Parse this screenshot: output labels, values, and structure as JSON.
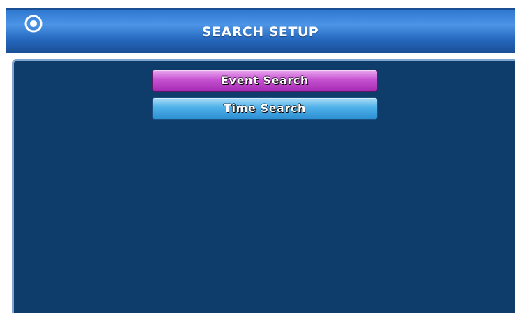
{
  "header": {
    "title": "SEARCH SETUP",
    "logo_icon": "ring-logo-icon"
  },
  "menu": {
    "items": [
      {
        "label": "Event Search",
        "state": "selected",
        "color": "#c652d1"
      },
      {
        "label": "Time Search",
        "state": "normal",
        "color": "#4fb1ea"
      }
    ]
  },
  "colors": {
    "titlebar": "#2f78d0",
    "panel_background": "#0f3d6b",
    "panel_border": "#7fa7cf"
  }
}
